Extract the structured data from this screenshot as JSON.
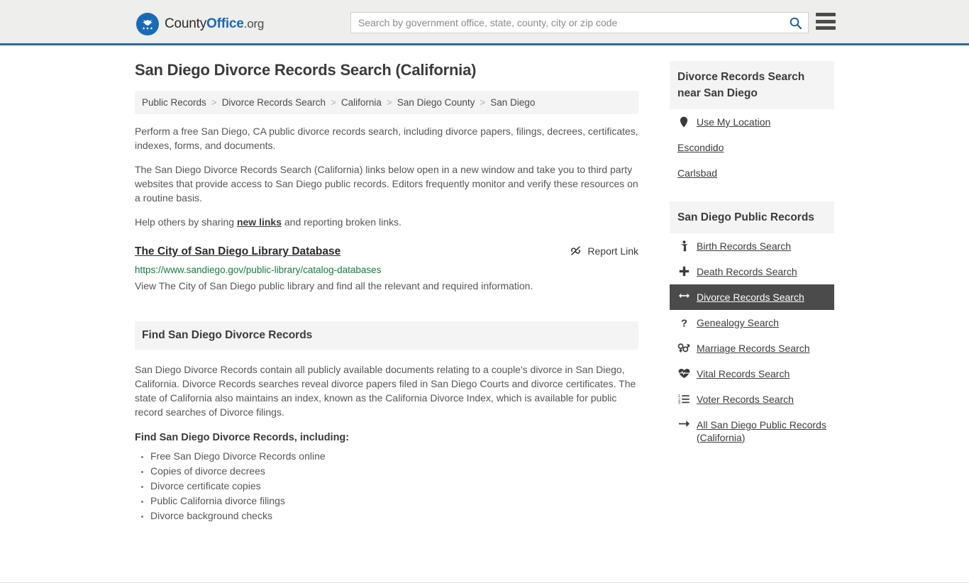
{
  "header": {
    "logo": {
      "icon": "eagle-seal-icon",
      "text_county": "County",
      "text_office": "Office",
      "text_org": ".org"
    },
    "search": {
      "placeholder": "Search by government office, state, county, city or zip code",
      "value": "",
      "search_icon": "search-icon"
    },
    "menu_icon": "hamburger-menu-icon"
  },
  "page": {
    "title": "San Diego Divorce Records Search (California)"
  },
  "breadcrumb": {
    "separator": ">",
    "items": [
      {
        "label": "Public Records",
        "current": false
      },
      {
        "label": "Divorce Records Search",
        "current": false
      },
      {
        "label": "California",
        "current": false
      },
      {
        "label": "San Diego County",
        "current": false
      },
      {
        "label": "San Diego",
        "current": true
      }
    ]
  },
  "intro": {
    "paragraph_1": "Perform a free San Diego, CA public divorce records search, including divorce papers, filings, decrees, certificates, indexes, forms, and documents.",
    "paragraph_2": "The San Diego Divorce Records Search (California) links below open in a new window and take you to third party websites that provide access to San Diego public records. Editors frequently monitor and verify these resources on a routine basis.",
    "paragraph_3_pre": "Help others by sharing ",
    "paragraph_3_link": "new links",
    "paragraph_3_post": " and reporting broken links."
  },
  "result": {
    "title": "The City of San Diego Library Database",
    "url": "https://www.sandiego.gov/public-library/catalog-databases",
    "description": "View The City of San Diego public library and find all the relevant and required information.",
    "report_label": "Report Link",
    "report_icon": "broken-link-icon"
  },
  "find_section": {
    "heading": "Find San Diego Divorce Records",
    "paragraph": "San Diego Divorce Records contain all publicly available documents relating to a couple's divorce in San Diego, California. Divorce Records searches reveal divorce papers filed in San Diego Courts and divorce certificates. The state of California also maintains an index, known as the California Divorce Index, which is available for public record searches of Divorce filings.",
    "subheading": "Find San Diego Divorce Records, including:",
    "bullets": [
      "Free San Diego Divorce Records online",
      "Copies of divorce decrees",
      "Divorce certificate copies",
      "Public California divorce filings",
      "Divorce background checks"
    ]
  },
  "sidebar": {
    "near_section": {
      "heading": "Divorce Records Search near San Diego",
      "items": [
        {
          "label": "Use My Location",
          "icon": "map-pin-icon",
          "active": false
        },
        {
          "label": "Escondido",
          "icon": "",
          "active": false
        },
        {
          "label": "Carlsbad",
          "icon": "",
          "active": false
        }
      ]
    },
    "records_section": {
      "heading": "San Diego Public Records",
      "items": [
        {
          "label": "Birth Records Search",
          "icon": "baby-icon",
          "active": false
        },
        {
          "label": "Death Records Search",
          "icon": "cross-icon",
          "active": false
        },
        {
          "label": "Divorce Records Search",
          "icon": "split-arrows-icon",
          "active": true
        },
        {
          "label": "Genealogy Search",
          "icon": "question-mark-icon",
          "active": false
        },
        {
          "label": "Marriage Records Search",
          "icon": "venus-mars-icon",
          "active": false
        },
        {
          "label": "Vital Records Search",
          "icon": "heartbeat-icon",
          "active": false
        },
        {
          "label": "Voter Records Search",
          "icon": "ordered-list-icon",
          "active": false
        },
        {
          "label": "All San Diego Public Records (California)",
          "icon": "arrow-right-icon",
          "active": false
        }
      ]
    }
  },
  "colors": {
    "header_bg": "#eeeeec",
    "header_border": "#30699b",
    "brand_blue": "#1a6bb5",
    "band_bg": "#f4f4f4",
    "active_bg": "#4b4b4b",
    "url_green": "#1a7a43",
    "body_text": "#555555"
  }
}
